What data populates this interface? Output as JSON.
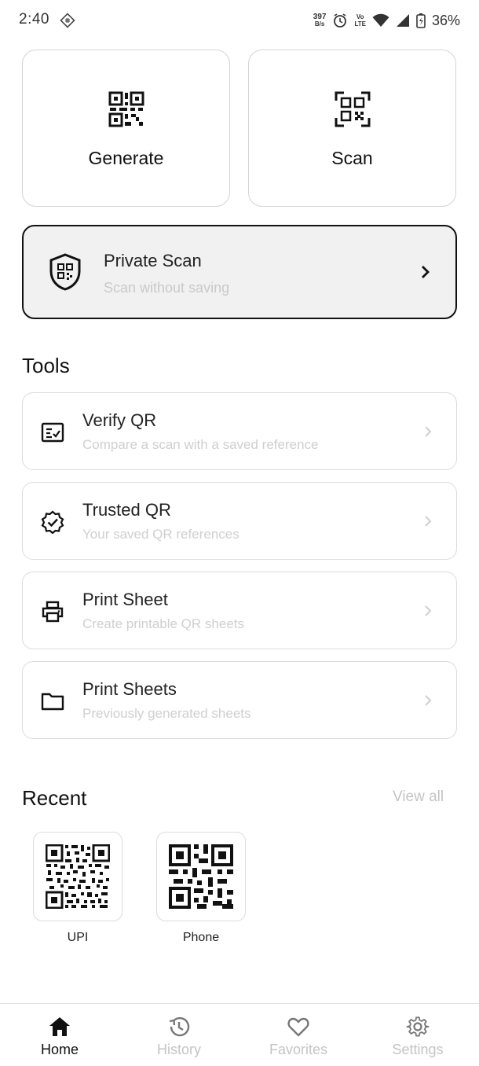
{
  "status_bar": {
    "time": "2:40",
    "net_speed_value": "397",
    "net_speed_unit": "B/s",
    "volte_top": "Vo",
    "volte_bottom": "LTE",
    "battery_percent": "36%",
    "icons": [
      "hashed-diamond-icon",
      "alarm-icon",
      "wifi-icon",
      "signal-icon",
      "battery-charging-icon"
    ]
  },
  "actions": {
    "generate": {
      "label": "Generate",
      "icon": "qr-code-icon"
    },
    "scan": {
      "label": "Scan",
      "icon": "qr-scan-icon"
    }
  },
  "private_scan": {
    "title": "Private Scan",
    "subtitle": "Scan without saving",
    "icon": "shield-qr-icon"
  },
  "tools": {
    "heading": "Tools",
    "items": [
      {
        "title": "Verify QR",
        "subtitle": "Compare a scan with a saved reference",
        "icon": "checklist-icon"
      },
      {
        "title": "Trusted QR",
        "subtitle": "Your saved QR references",
        "icon": "verified-badge-icon"
      },
      {
        "title": "Print Sheet",
        "subtitle": "Create printable QR sheets",
        "icon": "printer-icon"
      },
      {
        "title": "Print Sheets",
        "subtitle": "Previously generated sheets",
        "icon": "folder-icon"
      }
    ]
  },
  "recent": {
    "heading": "Recent",
    "view_all": "View all",
    "items": [
      {
        "label": "UPI"
      },
      {
        "label": "Phone"
      }
    ]
  },
  "bottom_nav": {
    "items": [
      {
        "label": "Home",
        "icon": "home-icon",
        "active": true
      },
      {
        "label": "History",
        "icon": "history-icon",
        "active": false
      },
      {
        "label": "Favorites",
        "icon": "heart-icon",
        "active": false
      },
      {
        "label": "Settings",
        "icon": "gear-icon",
        "active": false
      }
    ]
  },
  "colors": {
    "text_primary": "#111111",
    "text_muted": "#c4c4c4",
    "card_border": "#d4d4d4",
    "private_scan_bg": "#f1f1f1"
  }
}
